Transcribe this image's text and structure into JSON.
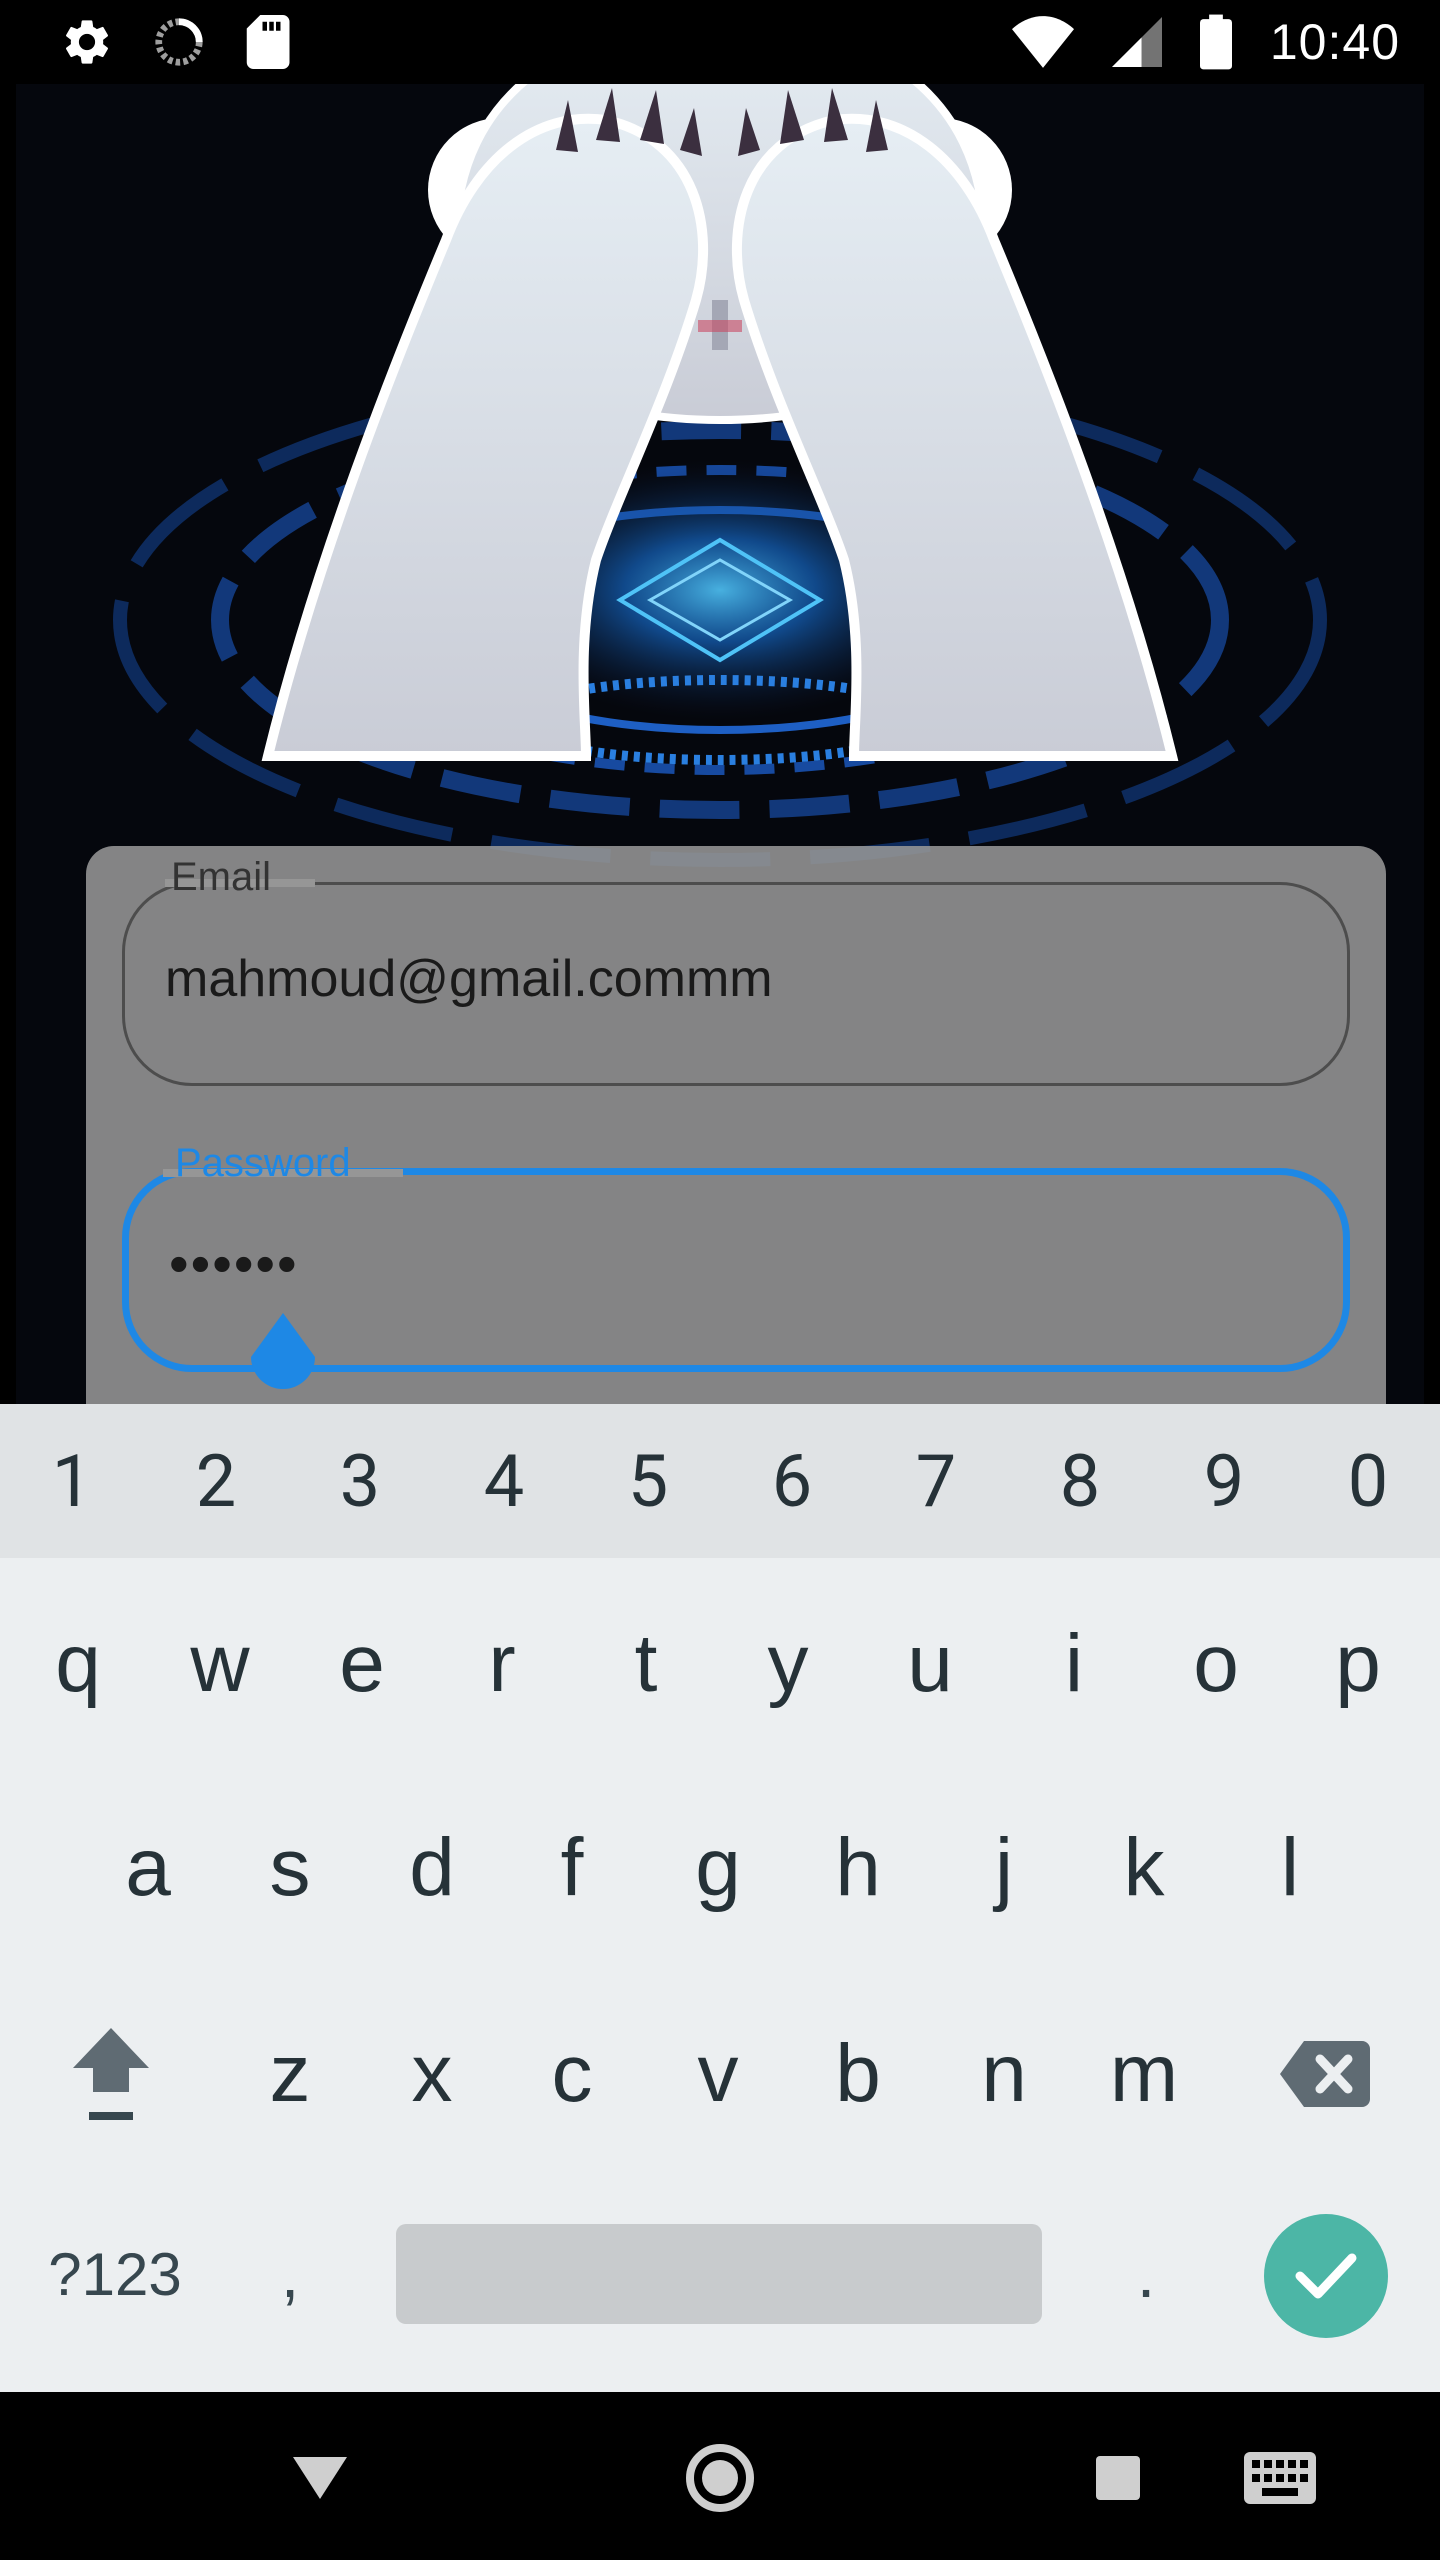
{
  "status_bar": {
    "time": "10:40",
    "left_icons": [
      "settings-icon",
      "loading-icon",
      "sd-card-icon"
    ],
    "right_icons": [
      "wifi-icon",
      "signal-icon",
      "battery-icon"
    ]
  },
  "form": {
    "email": {
      "label": "Email",
      "value": "mahmoud@gmail.commm"
    },
    "password": {
      "label": "Password",
      "value": "••••••"
    }
  },
  "colors": {
    "accent": "#1e88e5",
    "done_key": "#4cb6a6",
    "card": "#969696",
    "keyboard_bg": "#eceff1"
  },
  "keyboard": {
    "numbers": [
      "1",
      "2",
      "3",
      "4",
      "5",
      "6",
      "7",
      "8",
      "9",
      "0"
    ],
    "row1": [
      "q",
      "w",
      "e",
      "r",
      "t",
      "y",
      "u",
      "i",
      "o",
      "p"
    ],
    "row2": [
      "a",
      "s",
      "d",
      "f",
      "g",
      "h",
      "j",
      "k",
      "l"
    ],
    "row3": [
      "z",
      "x",
      "c",
      "v",
      "b",
      "n",
      "m"
    ],
    "symbols_label": "?123",
    "comma": ",",
    "period": ".",
    "shift_icon": "shift-icon",
    "backspace_icon": "backspace-icon",
    "done_icon": "check-icon"
  },
  "nav_bar": {
    "icons": [
      "back-icon",
      "home-icon",
      "recents-icon",
      "keyboard-switch-icon"
    ]
  }
}
